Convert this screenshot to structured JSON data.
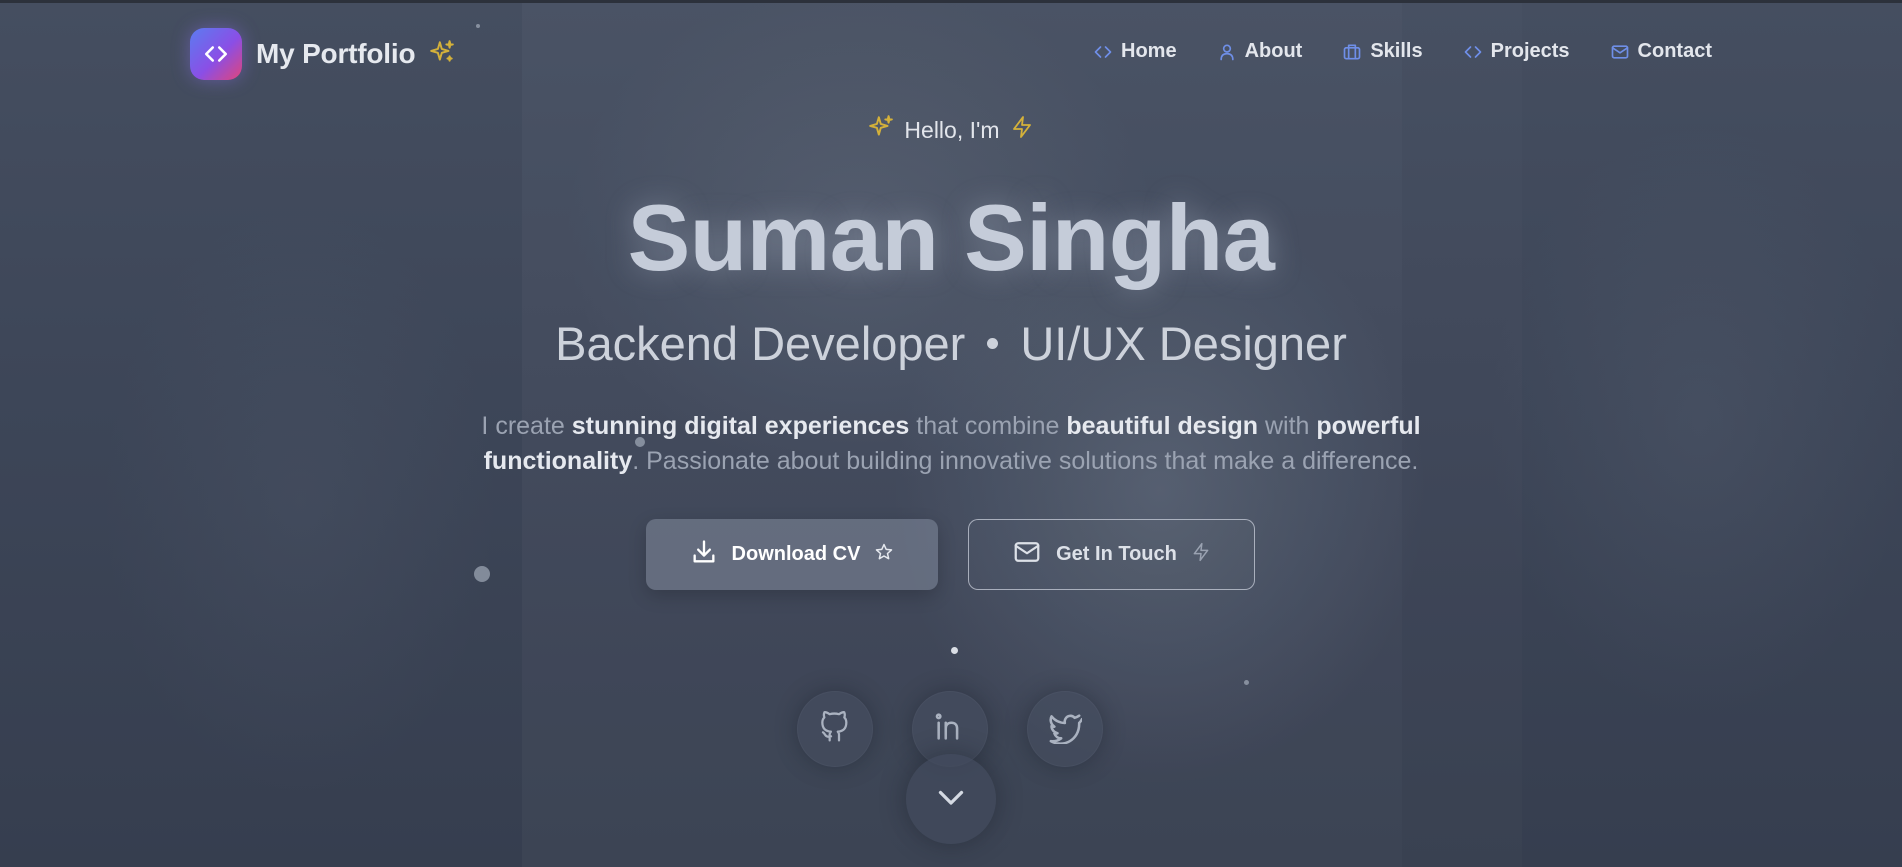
{
  "brand": {
    "title": "My Portfolio",
    "logo_icon": "code-icon",
    "accent_icon": "sparkles-icon"
  },
  "nav": {
    "items": [
      {
        "label": "Home",
        "icon": "code-icon"
      },
      {
        "label": "About",
        "icon": "user-icon"
      },
      {
        "label": "Skills",
        "icon": "briefcase-icon"
      },
      {
        "label": "Projects",
        "icon": "code-icon"
      },
      {
        "label": "Contact",
        "icon": "mail-icon"
      }
    ]
  },
  "hero": {
    "greeting": "Hello, I'm",
    "name": "Suman Singha",
    "roles": [
      "Backend Developer",
      "UI/UX Designer"
    ],
    "description": {
      "p1": "I create ",
      "b1": "stunning digital experiences",
      "p2": " that combine ",
      "b2": "beautiful design",
      "p3": " with ",
      "b3": "powerful functionality",
      "p4": ". Passionate about building innovative solutions that make a difference."
    }
  },
  "actions": {
    "download_cv": "Download CV",
    "get_in_touch": "Get In Touch"
  },
  "socials": [
    {
      "name": "GitHub",
      "icon": "github-icon"
    },
    {
      "name": "LinkedIn",
      "icon": "linkedin-icon"
    },
    {
      "name": "Twitter",
      "icon": "twitter-icon"
    }
  ],
  "colors": {
    "accent_gold": "#d4b13a",
    "accent_blue": "#6f8fe8",
    "background": "#3b4455"
  }
}
